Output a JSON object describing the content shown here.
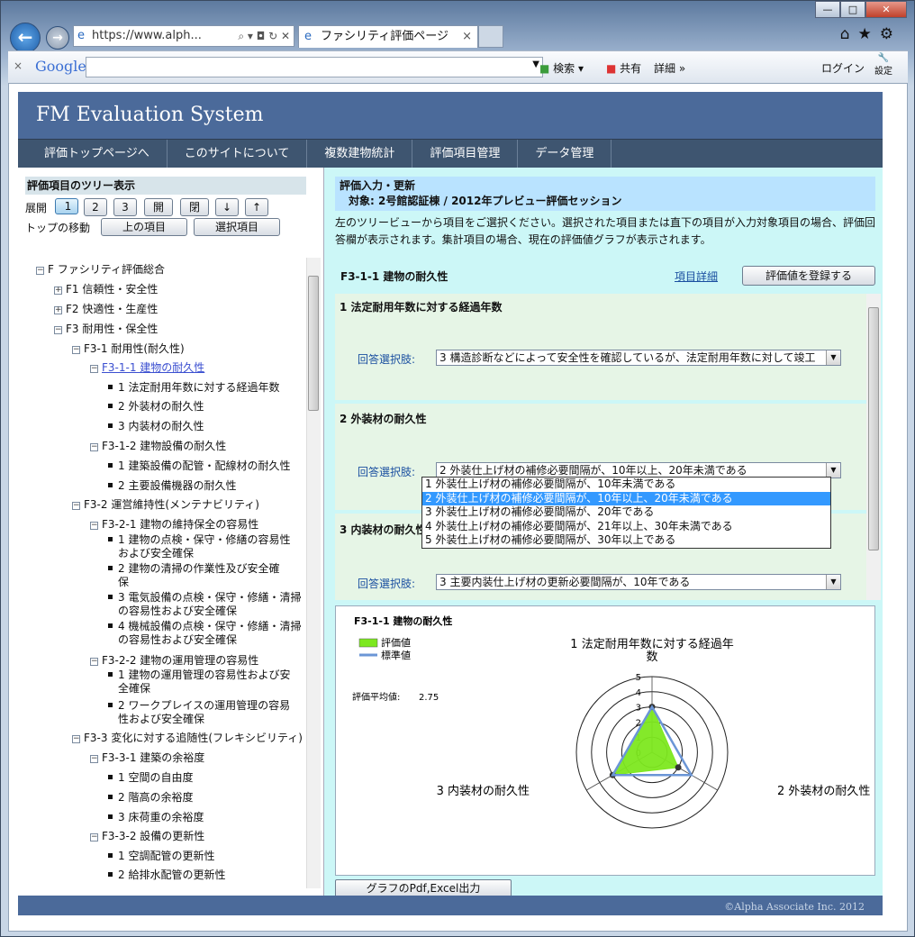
{
  "browser": {
    "address": "https://www.alph...",
    "tab_title": "ファシリティ評価ページ",
    "window_controls": [
      "—",
      "□",
      "✕"
    ],
    "google_label": "Google",
    "google_search_btn": "検索",
    "share_label": "共有",
    "more_label": "詳細 »",
    "login_label": "ログイン",
    "settings_label": "設定"
  },
  "header": {
    "title": "FM Evaluation System",
    "menu": [
      "評価トップページへ",
      "このサイトについて",
      "複数建物統計",
      "評価項目管理",
      "データ管理"
    ]
  },
  "left": {
    "title": "評価項目のツリー表示",
    "expand_label": "展開",
    "expand_buttons": [
      "1",
      "2",
      "3",
      "開",
      "閉",
      "↓",
      "↑"
    ],
    "move_label": "トップの移動",
    "move_buttons": [
      "上の項目",
      "選択項目"
    ],
    "tree": [
      {
        "text": "F ファシリティ評価総合",
        "ex": "−"
      },
      {
        "text": "F1 信頼性・安全性",
        "ex": "+"
      },
      {
        "text": "F2 快適性・生産性",
        "ex": "+"
      },
      {
        "text": "F3 耐用性・保全性",
        "ex": "−"
      },
      {
        "text": "F3-1 耐用性(耐久性)",
        "ex": "−"
      },
      {
        "text": "F3-1-1 建物の耐久性",
        "ex": "−"
      },
      {
        "text": "1 法定耐用年数に対する経過年数"
      },
      {
        "text": "2 外装材の耐久性"
      },
      {
        "text": "3 内装材の耐久性"
      },
      {
        "text": "F3-1-2 建物設備の耐久性",
        "ex": "−"
      },
      {
        "text": "1 建築設備の配管・配線材の耐久性"
      },
      {
        "text": "2 主要設備機器の耐久性"
      },
      {
        "text": "F3-2 運営維持性(メンテナビリティ)",
        "ex": "−"
      },
      {
        "text": "F3-2-1 建物の維持保全の容易性",
        "ex": "−"
      },
      {
        "text": "1 建物の点検・保守・修繕の容易性",
        "text2": "および安全確保"
      },
      {
        "text": "2 建物の清掃の作業性及び安全確",
        "text2": "保"
      },
      {
        "text": "3 電気設備の点検・保守・修繕・清掃",
        "text2": "の容易性および安全確保"
      },
      {
        "text": "4 機械設備の点検・保守・修繕・清掃",
        "text2": "の容易性および安全確保"
      },
      {
        "text": "F3-2-2 建物の運用管理の容易性",
        "ex": "−"
      },
      {
        "text": "1 建物の運用管理の容易性および安",
        "text2": "全確保"
      },
      {
        "text": "2 ワークプレイスの運用管理の容易",
        "text2": "性および安全確保"
      },
      {
        "text": "F3-3 変化に対する追随性(フレキシビリティ)",
        "ex": "−"
      },
      {
        "text": "F3-3-1 建築の余裕度",
        "ex": "−"
      },
      {
        "text": "1 空間の自由度"
      },
      {
        "text": "2 階高の余裕度"
      },
      {
        "text": "3 床荷重の余裕度"
      },
      {
        "text": "F3-3-2 設備の更新性",
        "ex": "−"
      },
      {
        "text": "1 空調配管の更新性"
      },
      {
        "text": "2 給排水配管の更新性"
      }
    ]
  },
  "right": {
    "title1": "評価入力・更新",
    "title2": "対象: 2号館認証棟 / 2012年プレビュー評価セッション",
    "desc": "左のツリービューから項目をご選択ください。選択された項目または直下の項目が入力対象項目の場合、評価回答欄が表示されます。集計項目の場合、現在の評価値グラフが表示されます。",
    "section_title": "F3-1-1 建物の耐久性",
    "detail_link": "項目詳細",
    "register_btn": "評価値を登録する",
    "answer_label": "回答選択肢:",
    "questions": [
      {
        "title": "1 法定耐用年数に対する経過年数",
        "answer": "3 構造診断などによって安全性を確認しているが、法定耐用年数に対して竣工"
      },
      {
        "title": "2 外装材の耐久性",
        "answer": "2 外装仕上げ材の補修必要間隔が、10年以上、20年未満である"
      },
      {
        "title": "3 内装材の耐久性",
        "answer": "3 主要内装仕上げ材の更新必要間隔が、10年である"
      }
    ],
    "dropdown": [
      "1 外装仕上げ材の補修必要間隔が、10年未満である",
      "2 外装仕上げ材の補修必要間隔が、10年以上、20年未満である",
      "3 外装仕上げ材の補修必要間隔が、20年である",
      "4 外装仕上げ材の補修必要間隔が、21年以上、30年未満である",
      "5 外装仕上げ材の補修必要間隔が、30年以上である"
    ],
    "export_btn": "グラフのPdf,Excel出力"
  },
  "chart_data": {
    "type": "radar",
    "title": "F3-1-1 建物の耐久性",
    "legend": [
      "評価値",
      "標準値"
    ],
    "avg_label": "評価平均値:",
    "avg_value": "2.75",
    "axes": [
      "1 法定耐用年数に対する経過年数",
      "2 外装材の耐久性",
      "3 内装材の耐久性"
    ],
    "axis_label_lines": [
      [
        "1 法定耐用年数に対する経過年",
        "数"
      ],
      [
        "2 外装材の耐久性"
      ],
      [
        "3 内装材の耐久性"
      ]
    ],
    "rlim": [
      0,
      5
    ],
    "ticks": [
      "0",
      "1",
      "2",
      "3",
      "4",
      "5"
    ],
    "series": [
      {
        "name": "評価値",
        "values": [
          3,
          2,
          3
        ],
        "color": "#7de81f"
      },
      {
        "name": "標準値",
        "values": [
          3,
          3,
          3
        ],
        "color": "#6b96d6"
      }
    ]
  },
  "footer": {
    "copyright": "©Alpha Associate Inc. 2012"
  }
}
